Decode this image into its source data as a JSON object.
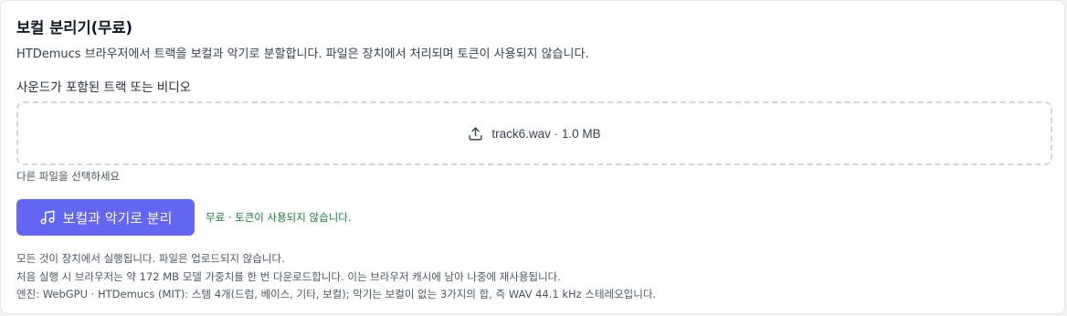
{
  "header": {
    "title": "보컬 분리기(무료)",
    "description": "HTDemucs 브라우저에서 트랙을 보컬과 악기로 분할합니다. 파일은 장치에서 처리되며 토큰이 사용되지 않습니다."
  },
  "upload": {
    "label": "사운드가 포함된 트랙 또는 비디오",
    "icon": "upload-icon",
    "file_info": "track6.wav · 1.0 MB",
    "hint": "다른 파일을 선택하세요"
  },
  "action": {
    "button_label": "보컬과 악기로 분리",
    "button_icon": "music-note-icon",
    "status": "무료 · 토큰이 사용되지 않습니다."
  },
  "notes": [
    "모든 것이 장치에서 실행됩니다. 파일은 업로드되지 않습니다.",
    "처음 실행 시 브라우저는 약 172 MB 모델 가중치를 한 번 다운로드합니다. 이는 브라우저 캐시에 남아 나중에 재사용됩니다.",
    "엔진: WebGPU · HTDemucs (MIT): 스템 4개(드럼, 베이스, 기타, 보컬); 악기는 보컬이 없는 3가지의 합, 즉 WAV 44.1 kHz 스테레오입니다."
  ],
  "colors": {
    "accent": "#6366f1",
    "status_green": "#15803d"
  }
}
